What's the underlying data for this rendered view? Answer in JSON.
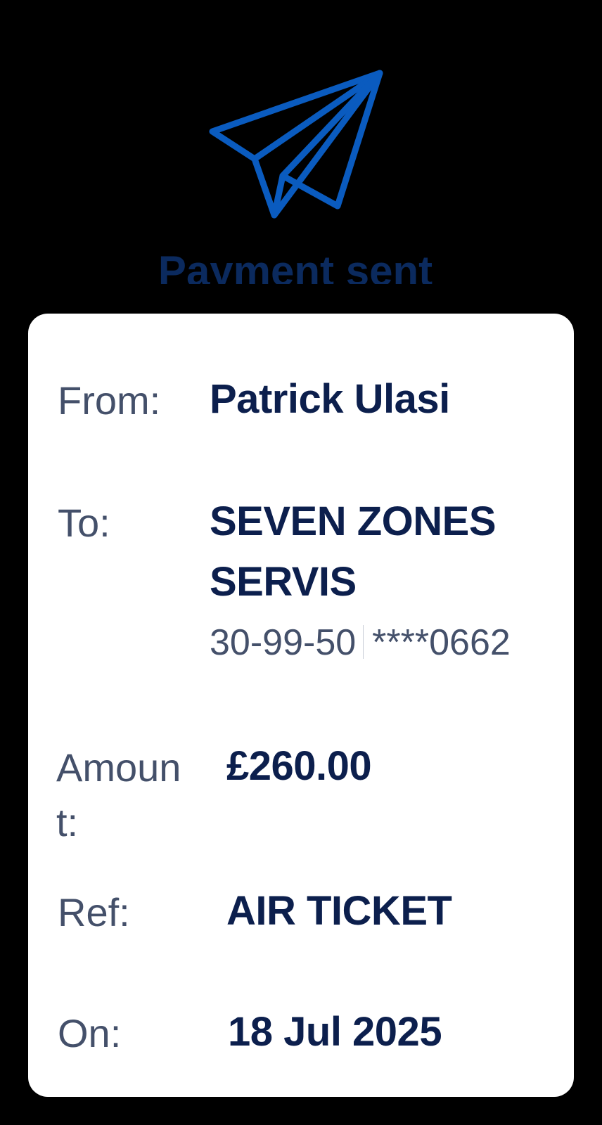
{
  "header": {
    "icon": "paper-plane-icon",
    "title": "Payment sent",
    "accent_color": "#0a5bbf"
  },
  "details": {
    "from_label": "From:",
    "from_value": "Patrick Ulasi",
    "to_label": "To:",
    "to_value_line1": "SEVEN ZONES",
    "to_value_line2": "SERVIS",
    "sort_code": "30-99-50",
    "account_number": "****0662",
    "amount_label_line1": "Amoun",
    "amount_label_line2": "t:",
    "amount_value": "£260.00",
    "ref_label": "Ref:",
    "ref_value": "AIR TICKET",
    "on_label": "On:",
    "on_value": "18 Jul 2025"
  }
}
